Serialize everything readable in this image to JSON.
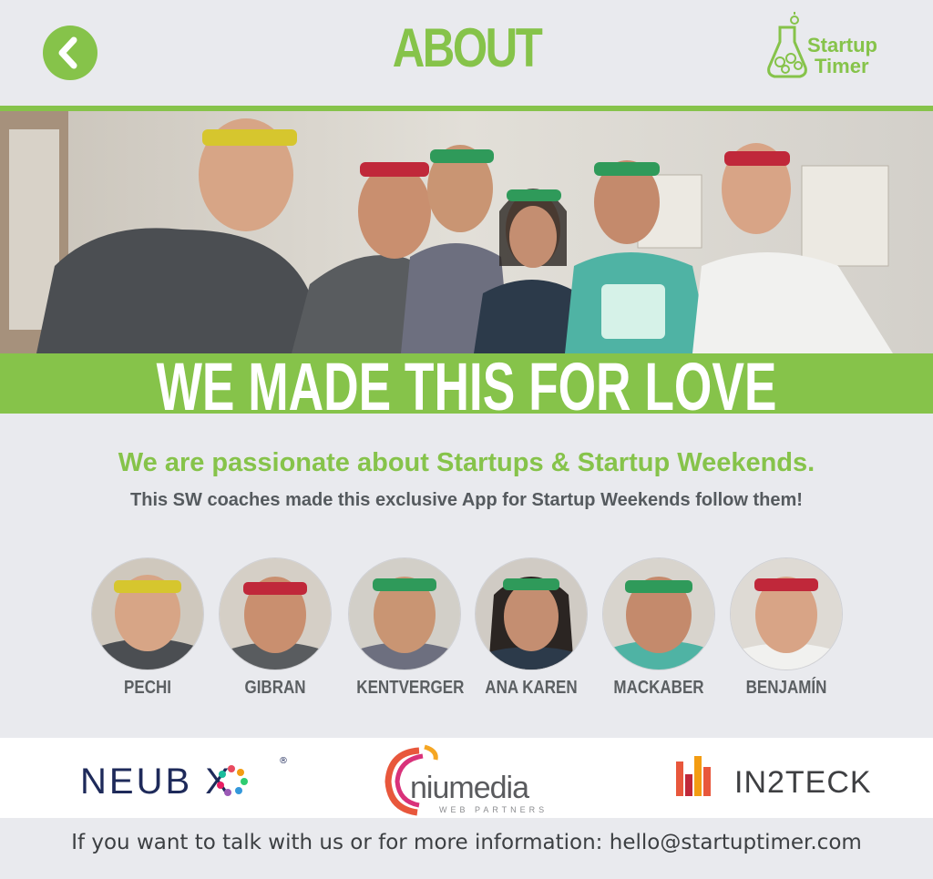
{
  "header": {
    "title": "ABOUT",
    "back_icon": "chevron-left-icon",
    "brand": {
      "line1": "Startup",
      "line2": "Timer",
      "icon": "flask-timer-icon"
    }
  },
  "banner": {
    "text": "WE MADE THIS FOR LOVE"
  },
  "intro": {
    "headline": "We are passionate about Startups & Startup Weekends.",
    "subline": "This SW coaches made this exclusive App for Startup Weekends follow them!"
  },
  "coaches": [
    {
      "name": "PECHI",
      "band_color": "#d6c62e"
    },
    {
      "name": "GIBRAN",
      "band_color": "#c0283a"
    },
    {
      "name": "KENTVERGER",
      "band_color": "#2f9a5a"
    },
    {
      "name": "ANA KAREN",
      "band_color": "#2f9a5a"
    },
    {
      "name": "MACKABER",
      "band_color": "#2f9a5a"
    },
    {
      "name": "BENJAMÍN",
      "band_color": "#c0283a"
    }
  ],
  "partners": {
    "neubox": "NEUB X",
    "niumedia": "niumedia",
    "niumedia_sub": "WEB PARTNERS",
    "in2teck": "IN2TECK"
  },
  "footer": {
    "text": "If you want to talk with us or for more information: hello@startuptimer.com"
  },
  "colors": {
    "accent": "#86c34a",
    "background": "#e9eaee"
  }
}
